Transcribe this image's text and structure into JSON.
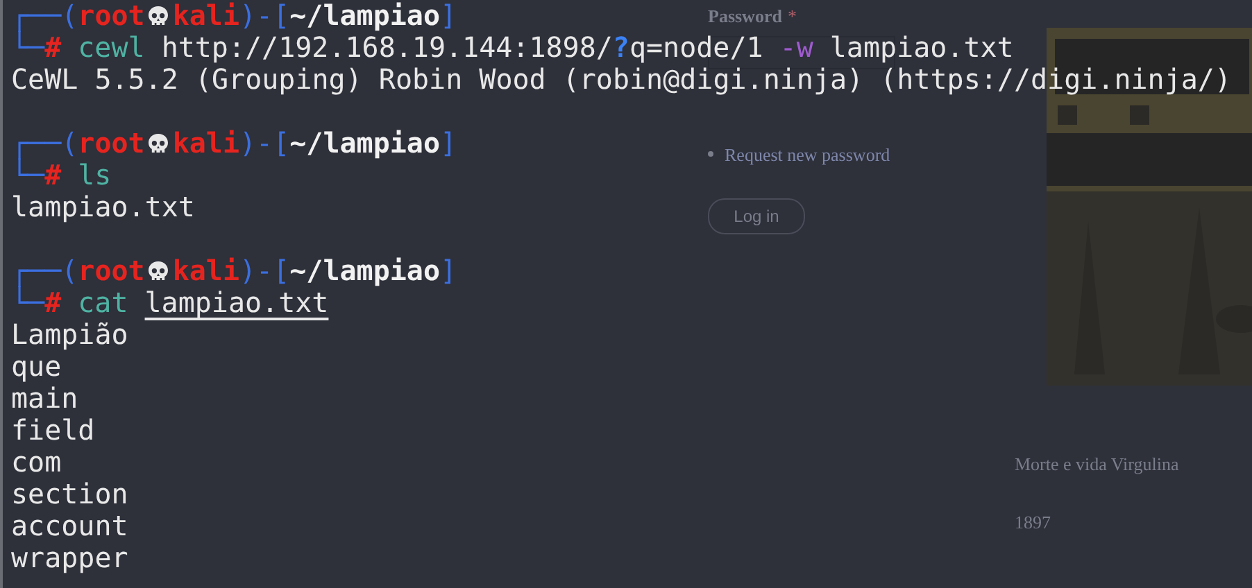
{
  "background_page": {
    "password_label": "Password",
    "required_mark": "*",
    "links": [
      "Request new password"
    ],
    "login_button": "Log in",
    "poster": {
      "kind": "picture"
    },
    "article": [
      "Morte e vida Virgulina",
      "1897"
    ]
  },
  "terminal": {
    "entries": [
      {
        "kind": "prompt",
        "frame_top": "┌──(",
        "user": "root",
        "host": "kali",
        "mid": ")-[",
        "cwd": "~/lampiao",
        "end": "]",
        "frame_bottom": "└─",
        "symbol": "#",
        "command": "cewl",
        "args": [
          {
            "parts": [
              {
                "text": "http://192.168.19.144:1898/",
                "kind": "plain"
              },
              {
                "text": "?",
                "kind": "glob"
              },
              {
                "text": "q=node/1",
                "kind": "plain"
              }
            ]
          },
          {
            "parts": [
              {
                "text": "-w",
                "kind": "option"
              }
            ]
          },
          {
            "parts": [
              {
                "text": "lampiao.txt",
                "kind": "plain"
              }
            ]
          }
        ]
      },
      {
        "kind": "output",
        "text": "CeWL 5.5.2 (Grouping) Robin Wood (robin@digi.ninja) (https://digi.ninja/)"
      },
      {
        "kind": "prompt",
        "frame_top": "┌──(",
        "user": "root",
        "host": "kali",
        "mid": ")-[",
        "cwd": "~/lampiao",
        "end": "]",
        "frame_bottom": "└─",
        "symbol": "#",
        "command": "ls"
      },
      {
        "kind": "output",
        "text": "lampiao.txt"
      },
      {
        "kind": "prompt",
        "frame_top": "┌──(",
        "user": "root",
        "host": "kali",
        "mid": ")-[",
        "cwd": "~/lampiao",
        "end": "]",
        "frame_bottom": "└─",
        "symbol": "#",
        "command": "cat",
        "args": [
          {
            "parts": [
              {
                "text": "lampiao.txt",
                "kind": "path"
              }
            ]
          }
        ]
      },
      {
        "kind": "output",
        "text": "Lampião"
      },
      {
        "kind": "output",
        "text": "que"
      },
      {
        "kind": "output",
        "text": "main"
      },
      {
        "kind": "output",
        "text": "field"
      },
      {
        "kind": "output",
        "text": "com"
      },
      {
        "kind": "output",
        "text": "section"
      },
      {
        "kind": "output",
        "text": "account"
      },
      {
        "kind": "output",
        "text": "wrapper"
      }
    ]
  }
}
